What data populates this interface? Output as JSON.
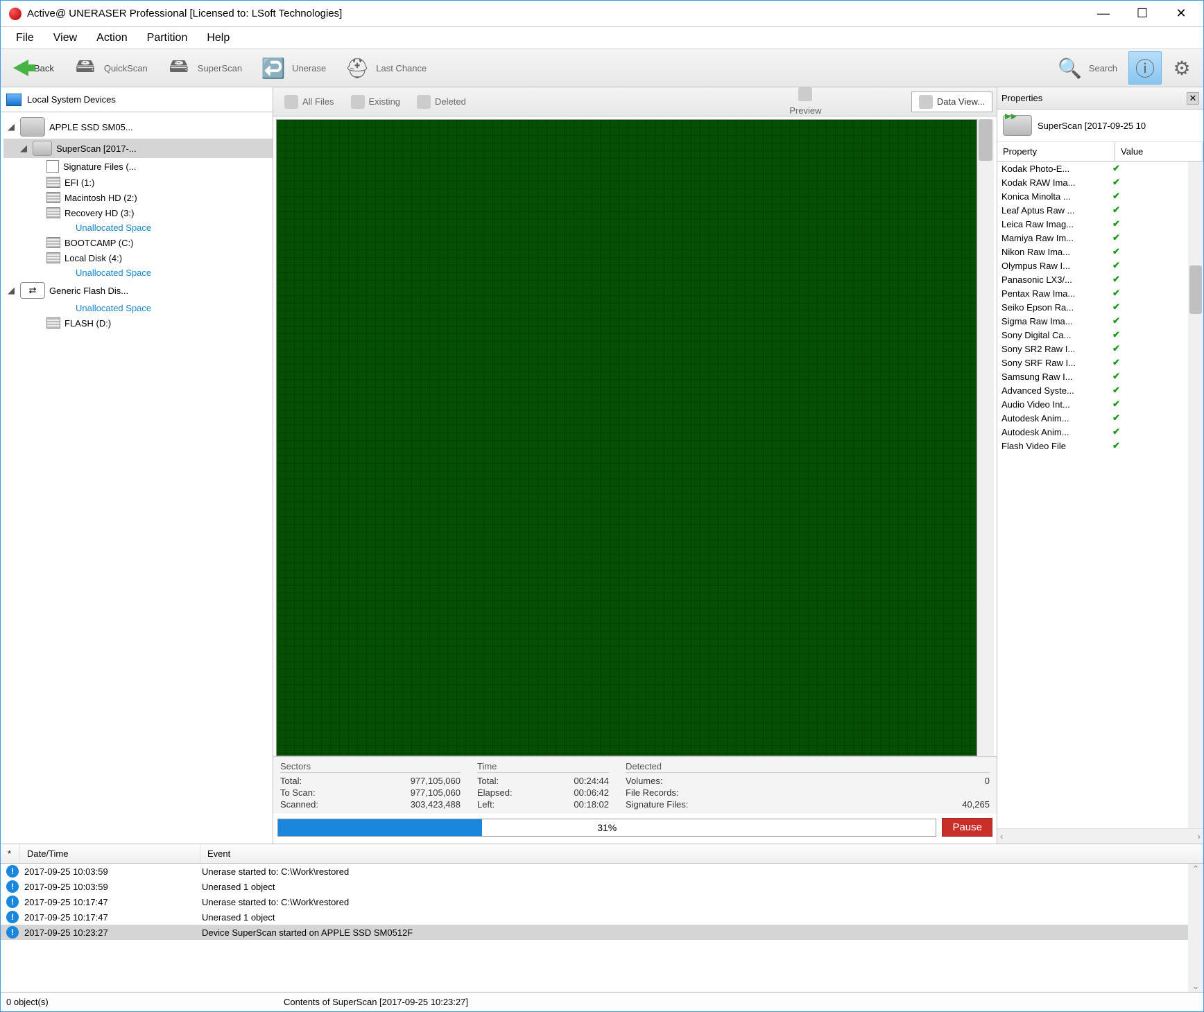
{
  "title": "Active@ UNERASER Professional [Licensed to: LSoft Technologies]",
  "menu": {
    "file": "File",
    "view": "View",
    "action": "Action",
    "partition": "Partition",
    "help": "Help"
  },
  "toolbar": {
    "back": "Back",
    "quickscan": "QuickScan",
    "superscan": "SuperScan",
    "unerase": "Unerase",
    "lastchance": "Last Chance",
    "search": "Search"
  },
  "left": {
    "title": "Local System Devices",
    "items": [
      {
        "label": "APPLE SSD SM05...",
        "type": "drive"
      },
      {
        "label": "SuperScan [2017-...",
        "type": "scan",
        "selected": true
      },
      {
        "label": "Signature Files (...",
        "type": "sig"
      },
      {
        "label": "EFI (1:)",
        "type": "vol"
      },
      {
        "label": "Macintosh HD (2:)",
        "type": "vol"
      },
      {
        "label": "Recovery HD (3:)",
        "type": "vol"
      },
      {
        "label": "Unallocated Space",
        "type": "unalloc"
      },
      {
        "label": "BOOTCAMP (C:)",
        "type": "vol"
      },
      {
        "label": "Local Disk (4:)",
        "type": "vol"
      },
      {
        "label": "Unallocated Space",
        "type": "unalloc"
      },
      {
        "label": "Generic Flash Dis...",
        "type": "drive2"
      },
      {
        "label": "Unallocated Space",
        "type": "unalloc"
      },
      {
        "label": "FLASH (D:)",
        "type": "vol"
      }
    ]
  },
  "viewbar": {
    "allfiles": "All Files",
    "existing": "Existing",
    "deleted": "Deleted",
    "preview": "Preview",
    "dataview": "Data View..."
  },
  "stats": {
    "sectors": {
      "header": "Sectors",
      "total_l": "Total:",
      "total_v": "977,105,060",
      "toscan_l": "To Scan:",
      "toscan_v": "977,105,060",
      "scanned_l": "Scanned:",
      "scanned_v": "303,423,488"
    },
    "time": {
      "header": "Time",
      "total_l": "Total:",
      "total_v": "00:24:44",
      "elapsed_l": "Elapsed:",
      "elapsed_v": "00:06:42",
      "left_l": "Left:",
      "left_v": "00:18:02"
    },
    "detected": {
      "header": "Detected",
      "volumes_l": "Volumes:",
      "volumes_v": "0",
      "records_l": "File Records:",
      "records_v": "",
      "sig_l": "Signature Files:",
      "sig_v": "40,265"
    }
  },
  "progress": {
    "pct_text": "31%",
    "pct": 31,
    "pause": "Pause"
  },
  "props": {
    "title": "Properties",
    "head": "SuperScan [2017-09-25 10",
    "col1": "Property",
    "col2": "Value",
    "rows": [
      "Kodak Photo-E...",
      "Kodak RAW Ima...",
      "Konica Minolta ...",
      "Leaf Aptus Raw ...",
      "Leica Raw Imag...",
      "Mamiya Raw Im...",
      "Nikon Raw Ima...",
      "Olympus Raw I...",
      "Panasonic LX3/...",
      "Pentax Raw Ima...",
      "Seiko Epson Ra...",
      "Sigma Raw Ima...",
      "Sony Digital Ca...",
      "Sony SR2 Raw I...",
      "Sony SRF Raw I...",
      "Samsung Raw I...",
      "Advanced Syste...",
      "Audio Video Int...",
      "Autodesk Anim...",
      "Autodesk Anim...",
      "Flash Video File"
    ]
  },
  "log": {
    "cols": {
      "star": "*",
      "dt": "Date/Time",
      "event": "Event"
    },
    "rows": [
      {
        "dt": "2017-09-25 10:03:59",
        "ev": "Unerase started to: C:\\Work\\restored"
      },
      {
        "dt": "2017-09-25 10:03:59",
        "ev": "Unerased 1 object"
      },
      {
        "dt": "2017-09-25 10:17:47",
        "ev": "Unerase started to: C:\\Work\\restored"
      },
      {
        "dt": "2017-09-25 10:17:47",
        "ev": "Unerased 1 object"
      },
      {
        "dt": "2017-09-25 10:23:27",
        "ev": "Device SuperScan started on APPLE SSD SM0512F",
        "sel": true
      }
    ]
  },
  "status": {
    "left": "0 object(s)",
    "center": "Contents of SuperScan [2017-09-25 10:23:27]"
  }
}
